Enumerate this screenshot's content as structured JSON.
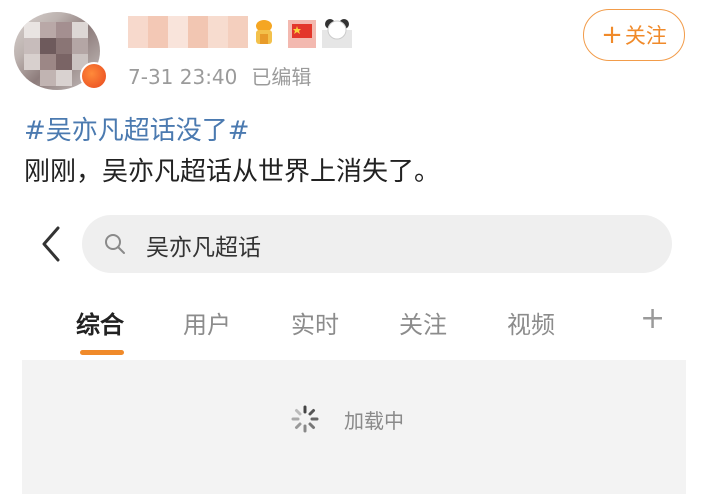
{
  "header": {
    "avatar": "blurred-avatar",
    "username": "",
    "emoji_icons": [
      "emoji-hat-icon",
      "emoji-flag-icon",
      "emoji-panda-icon"
    ],
    "timestamp": "7-31 23:40",
    "edited_label": "已编辑",
    "follow_button": {
      "plus": "+",
      "label": "关注"
    }
  },
  "post": {
    "topic": "#吴亦凡超话没了#",
    "text": "刚刚，吴亦凡超话从世界上消失了。"
  },
  "embedded_screenshot": {
    "search": {
      "query": "吴亦凡超话"
    },
    "tabs": [
      {
        "label": "综合",
        "active": true
      },
      {
        "label": "用户",
        "active": false
      },
      {
        "label": "实时",
        "active": false
      },
      {
        "label": "关注",
        "active": false
      },
      {
        "label": "视频",
        "active": false
      }
    ],
    "more_tab_symbol": "+",
    "loading_text": "加载中"
  },
  "colors": {
    "accent": "#f08a2a",
    "topic_link": "#4b7ab0",
    "text": "#222222",
    "muted": "#9b9b9b",
    "content_bg": "#f3f3f3"
  }
}
